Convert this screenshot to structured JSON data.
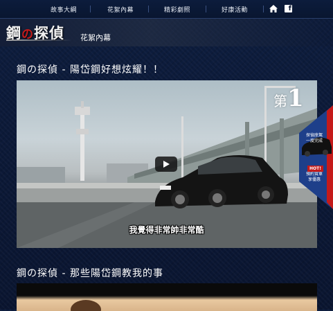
{
  "nav": {
    "items": [
      "故事大綱",
      "花絮內幕",
      "精彩劇照",
      "好康活動"
    ]
  },
  "header": {
    "logo_main_a": "鋼",
    "logo_mid": "の",
    "logo_main_b": "探偵",
    "section": "花絮內幕"
  },
  "videos": [
    {
      "title": "鋼の探偵 - 陽岱鋼好想炫耀！！",
      "subtitle": "我覺得非常帥非常酷",
      "badge_prefix": "第",
      "badge_number": "1"
    },
    {
      "title": "鋼の探偵 - 那些陽岱鋼教我的事"
    }
  ],
  "side_ad": {
    "line1": "探偵座駕",
    "line2": "一度完成",
    "hot": "HOT!",
    "line3": "預約賞車",
    "line4": "享優惠"
  },
  "colors": {
    "background": "#0b1733",
    "accent_red": "#c41a1a"
  },
  "icons": [
    "home-icon",
    "facebook-icon",
    "play-icon"
  ]
}
